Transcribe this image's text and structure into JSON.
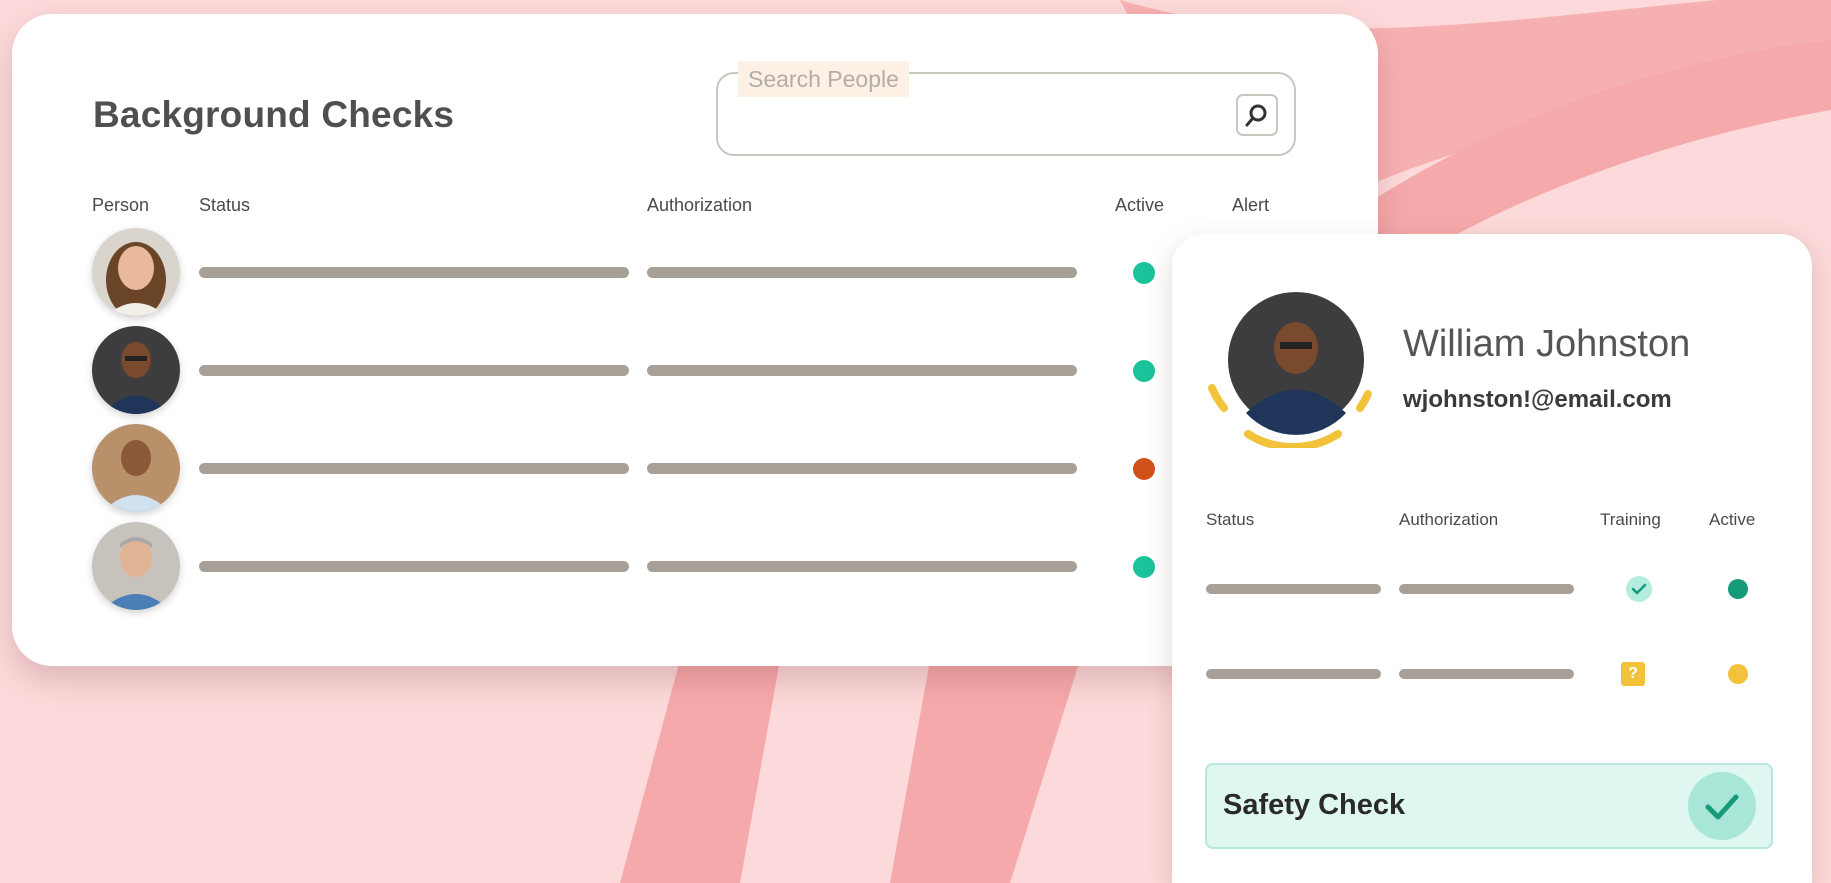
{
  "colors": {
    "background": "#fcd9da",
    "arc": "#f6a9aa",
    "bar": "#a7a097",
    "status_ok": "#1cc39a",
    "status_alert": "#d1511b",
    "teal_dark": "#159b78",
    "yellow": "#f2c23a"
  },
  "main": {
    "title": "Background Checks",
    "search": {
      "placeholder": "Search People",
      "icon": "search-icon"
    },
    "columns": [
      "Person",
      "Status",
      "Authorization",
      "Active",
      "Alert"
    ],
    "rows": [
      {
        "avatar": "woman-avatar",
        "active_status": "green"
      },
      {
        "avatar": "man-glasses-avatar",
        "active_status": "green"
      },
      {
        "avatar": "man-striped-shirt-avatar",
        "active_status": "orange"
      },
      {
        "avatar": "man-gray-hair-avatar",
        "active_status": "green"
      }
    ]
  },
  "profile": {
    "name": "William Johnston",
    "email": "wjohnston!@email.com",
    "columns": [
      "Status",
      "Authorization",
      "Training",
      "Active"
    ],
    "rows": [
      {
        "training": "check",
        "active": "dark-green"
      },
      {
        "training": "question",
        "active": "yellow"
      }
    ],
    "training_question_glyph": "?",
    "safety_check": {
      "label": "Safety Check",
      "icon": "checkmark-icon"
    }
  }
}
